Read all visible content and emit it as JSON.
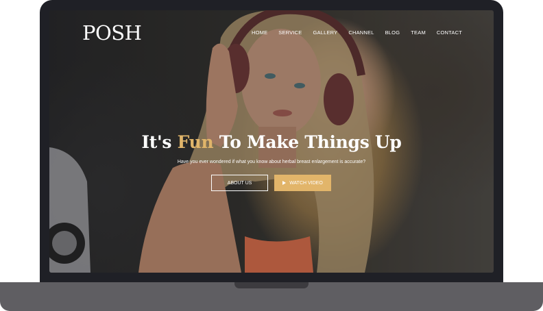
{
  "site": {
    "logo": "POSH",
    "nav": [
      "HOME",
      "SERVICE",
      "GALLERY",
      "CHANNEL",
      "BLOG",
      "TEAM",
      "CONTACT"
    ]
  },
  "hero": {
    "title_before": "It's ",
    "title_accent": "Fun",
    "title_after": " To Make Things Up",
    "subtitle": "Have you ever wondered if what you know about herbal breast enlargement is accurate?",
    "about_button": "ABOUT US",
    "watch_button": "WATCH VIDEO"
  },
  "colors": {
    "accent": "#e2b56a",
    "laptop_frame": "#1f2026",
    "laptop_base": "#5f5e62"
  },
  "icons": {
    "play": "play-icon"
  }
}
